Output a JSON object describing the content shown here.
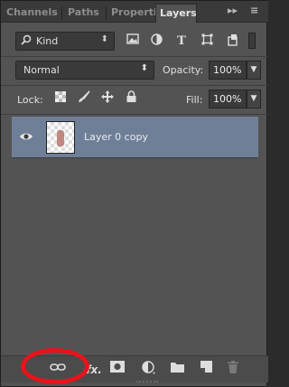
{
  "tabs": [
    {
      "label": "Channels",
      "active": false
    },
    {
      "label": "Paths",
      "active": false
    },
    {
      "label": "Properties",
      "active": false
    },
    {
      "label": "Layers",
      "active": true
    }
  ],
  "tabbar": {
    "collapse_glyph": "▸▸",
    "menu_glyph": "≡"
  },
  "filter": {
    "kind_label": "Kind",
    "kind_icon": "search-icon",
    "buttons": [
      "pixel-filter-icon",
      "adjustment-filter-icon",
      "type-filter-icon",
      "shape-filter-icon",
      "smart-object-filter-icon"
    ]
  },
  "blend": {
    "mode": "Normal",
    "opacity_label": "Opacity:",
    "opacity_value": "100%"
  },
  "lock": {
    "label": "Lock:",
    "fill_label": "Fill:",
    "fill_value": "100%"
  },
  "layers": [
    {
      "name": "Layer 0 copy",
      "visible": true,
      "selected": true
    }
  ],
  "bottom_buttons": [
    "link-layers-icon",
    "fx-icon",
    "add-mask-icon",
    "adjustment-layer-icon",
    "new-group-icon",
    "new-layer-icon",
    "delete-icon"
  ],
  "colors": {
    "panel": "#535353",
    "selected_layer": "#6f7f97",
    "highlight_circle": "#e8141b"
  }
}
